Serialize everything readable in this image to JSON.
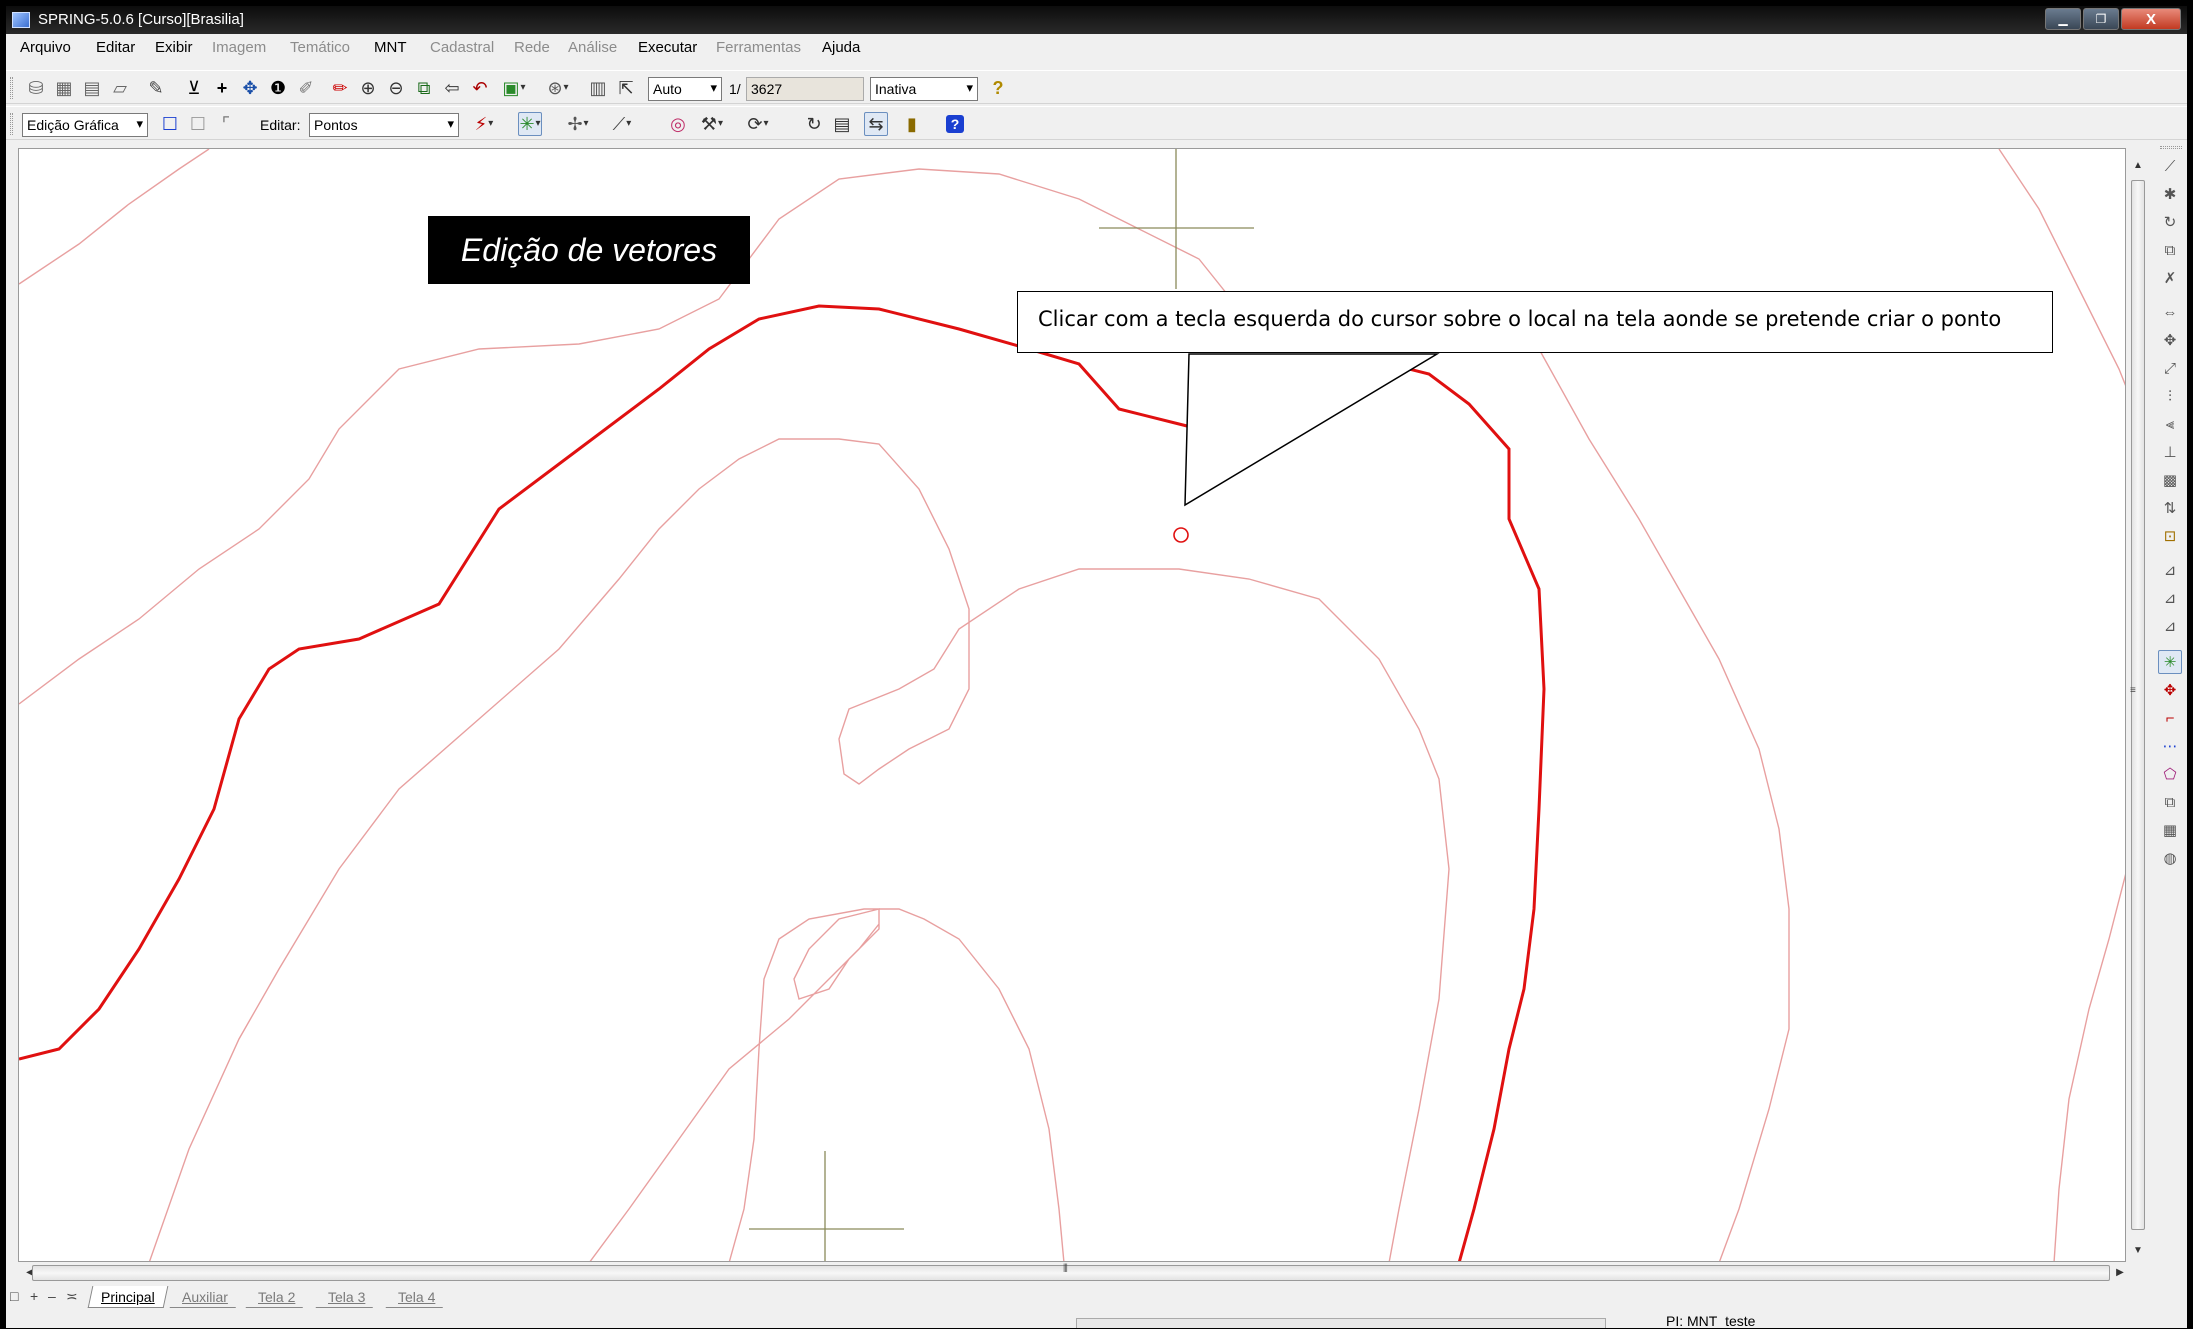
{
  "window": {
    "title": "SPRING-5.0.6 [Curso][Brasilia]",
    "minimize_icon": "minimize-icon",
    "maximize_icon": "maximize-icon",
    "close_label": "X"
  },
  "menu": {
    "items": [
      "Arquivo",
      "Editar",
      "Exibir",
      "Imagem",
      "Temático",
      "MNT",
      "Cadastral",
      "Rede",
      "Análise",
      "Executar",
      "Ferramentas",
      "Ajuda"
    ],
    "disabled": [
      "Imagem",
      "Temático",
      "Cadastral",
      "Rede",
      "Análise",
      "Ferramentas"
    ]
  },
  "toolbar1": {
    "scale_mode": "Auto",
    "scale_prefix": "1/",
    "scale_value": "3627",
    "status_combo": "Inativa",
    "icons": [
      "layers-icon",
      "map-icon",
      "stack-icon",
      "eraser-icon",
      "info-draw-icon",
      "pointer-icon",
      "plus-icon",
      "pan-icon",
      "info-icon",
      "tag-icon",
      "pen-icon",
      "zoom-in-icon",
      "zoom-out-icon",
      "zoom-area-icon",
      "back-icon",
      "undo-icon",
      "color-icon",
      "zoom-scale-icon",
      "grid-icon",
      "cursor-icon",
      "help-icon"
    ]
  },
  "toolbar2": {
    "mode_combo": "Edição Gráfica",
    "edit_label": "Editar:",
    "edit_combo": "Pontos",
    "icons": [
      "square-blue-icon",
      "square-grey-icon",
      "frame-icon",
      "snap-icon",
      "create-point-icon",
      "move-icon",
      "line-icon",
      "target-icon",
      "tools-icon",
      "rotate-icon",
      "undo-edit-icon",
      "save-icon",
      "fit-icon",
      "exit-icon",
      "help-icon"
    ]
  },
  "canvas": {
    "banner": "Edição de vetores",
    "callout": "Clicar com a tecla esquerda do cursor sobre o local na tela aonde se pretende criar o ponto",
    "colors": {
      "contour": "#e8a0a0",
      "main_contour": "#e01010",
      "crosshair": "#8a8a5a"
    }
  },
  "right_palette": {
    "icons": [
      "edit-line-icon",
      "edit-line2-icon",
      "rotate-obj-icon",
      "copy-obj-icon",
      "delete-line-icon",
      "move-horiz-icon",
      "move-all-icon",
      "scale-obj-icon",
      "split-icon",
      "join-icon",
      "align-icon",
      "grid-obj-icon",
      "swap-icon",
      "transform-icon",
      "node-icon",
      "node-edit-icon",
      "node-delete-icon",
      "create-point-icon",
      "move-point-icon",
      "delete-point-icon",
      "dots-icon",
      "polygon-icon",
      "copy-icon",
      "raster-icon",
      "palette-icon"
    ],
    "pressed_index": 17
  },
  "tabs": {
    "controls": [
      "□",
      "+",
      "–",
      "≍"
    ],
    "items": [
      "Principal",
      "Auxiliar",
      "Tela 2",
      "Tela 3",
      "Tela 4"
    ],
    "active": "Principal"
  },
  "status": {
    "text": "PI: MNT_teste"
  }
}
